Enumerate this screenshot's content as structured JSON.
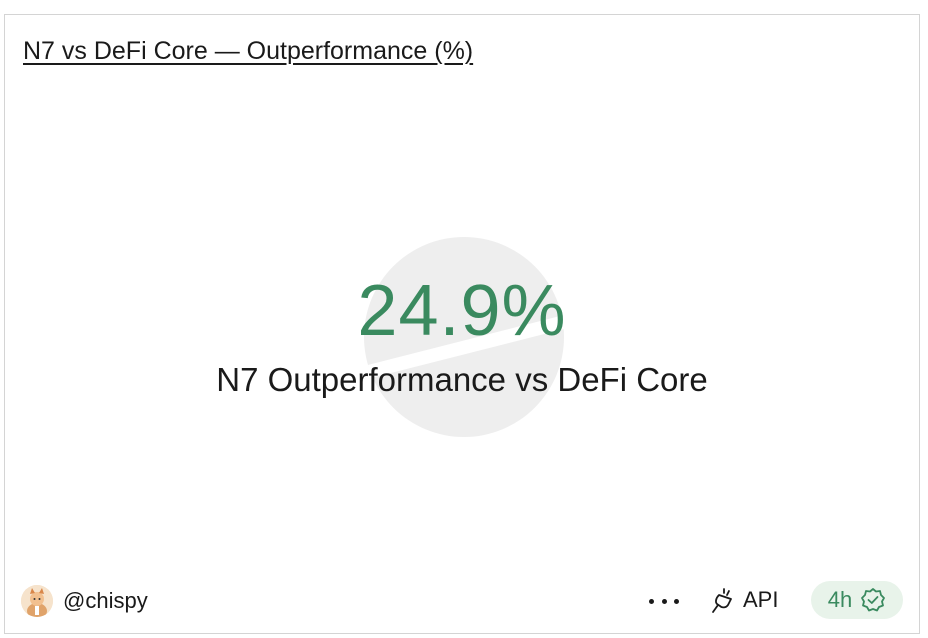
{
  "widget": {
    "title": "N7 vs DeFi Core — Outperformance (%)",
    "value": "24.9%",
    "label": "N7 Outperformance vs DeFi Core"
  },
  "footer": {
    "username": "@chispy",
    "api_label": "API",
    "freshness": "4h"
  },
  "colors": {
    "value": "#3a8a5f",
    "freshness_bg": "#e8f3ea",
    "watermark": "#eeeeee"
  },
  "icons": {
    "more": "more-horizontal-icon",
    "api": "plug-icon",
    "freshness": "check-badge-icon"
  }
}
